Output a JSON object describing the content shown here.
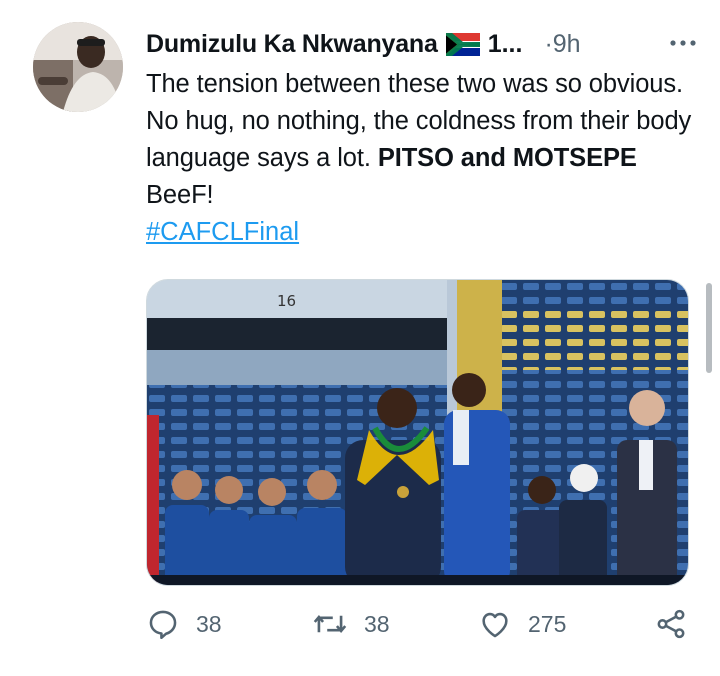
{
  "author": {
    "display_name": "Dumizulu Ka Nkwanyana",
    "flag_icon": "south-africa-flag-icon",
    "handle_truncated": "1...",
    "time_separator": "·",
    "timestamp": "9h"
  },
  "tweet": {
    "text_plain_1": "The tension between these two was so obvious. No hug, no nothing, the coldness from their body language says a lot. ",
    "text_bold_1": "PITSO and MOTSEPE",
    "text_plain_2": " BeeF!",
    "hashtag": "#CAFCLFinal"
  },
  "media": {
    "stand_number": "16"
  },
  "actions": {
    "replies": "38",
    "retweets": "38",
    "likes": "275"
  },
  "colors": {
    "accent": "#1d9bf0",
    "muted": "#536471"
  }
}
